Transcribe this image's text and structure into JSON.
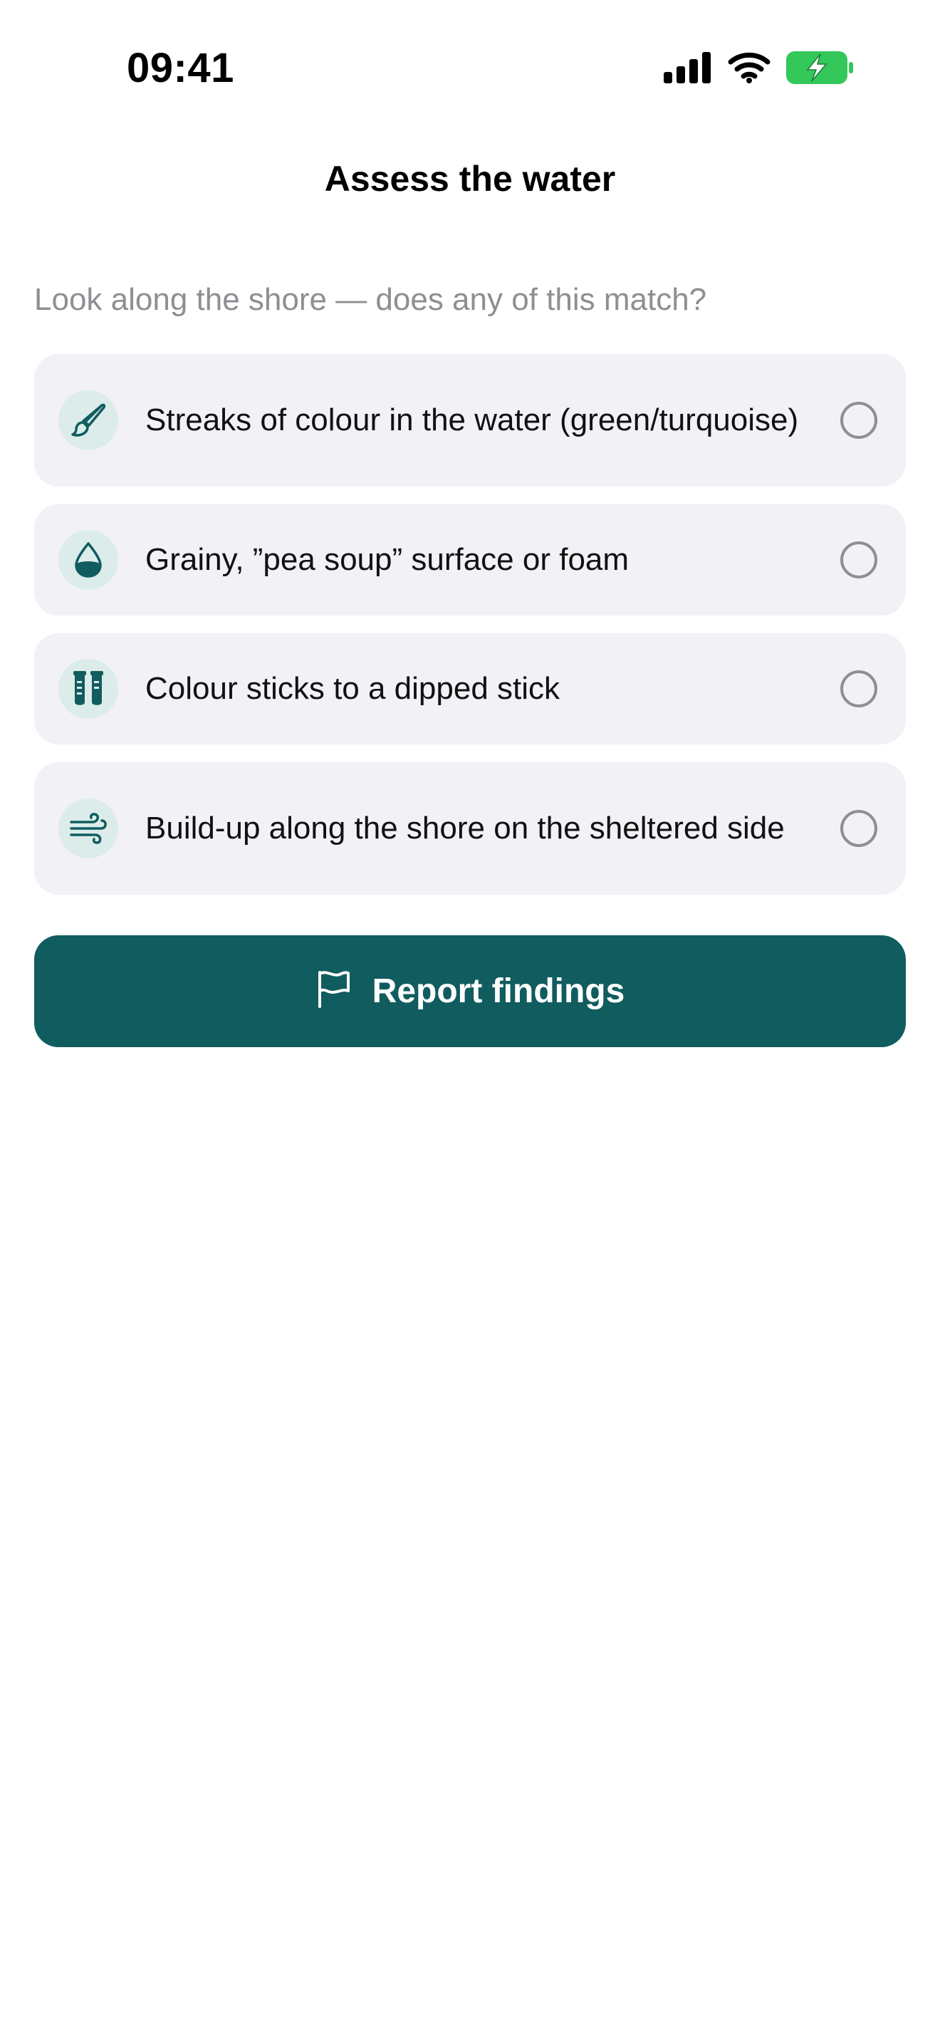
{
  "status_bar": {
    "time": "09:41",
    "icons": [
      "cellular-signal-icon",
      "wifi-icon",
      "battery-charging-icon"
    ],
    "battery_color": "#34c759"
  },
  "header": {
    "title": "Assess the water"
  },
  "prompt": "Look along the shore — does any of this match?",
  "options": [
    {
      "label": "Streaks of colour in the water (green/turquoise)",
      "icon": "paintbrush-icon",
      "selected": false
    },
    {
      "label": "Grainy, ”pea soup” surface or foam",
      "icon": "water-drop-icon",
      "selected": false
    },
    {
      "label": "Colour sticks to a dipped stick",
      "icon": "test-tubes-icon",
      "selected": false
    },
    {
      "label": "Build-up along the shore on the sheltered side",
      "icon": "wind-icon",
      "selected": false
    }
  ],
  "report_button": {
    "label": "Report findings",
    "icon": "flag-icon"
  },
  "colors": {
    "accent": "#115c5f",
    "icon_bg": "#dcecea",
    "card_bg": "#f1f1f6",
    "secondary_text": "#8e8e93"
  }
}
